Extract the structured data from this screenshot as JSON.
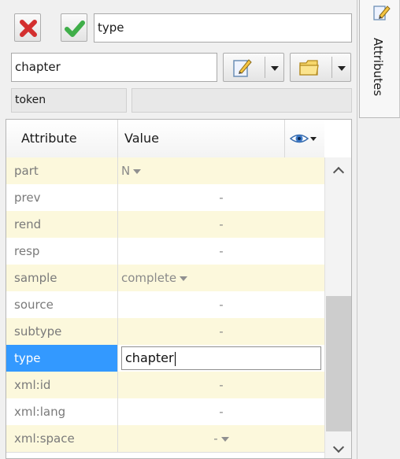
{
  "toolbar": {
    "name_value": "type",
    "element_value": "chapter",
    "token_label": "token"
  },
  "sidebar": {
    "tab_label": "Attributes"
  },
  "table": {
    "headers": {
      "attribute": "Attribute",
      "value": "Value"
    },
    "rows": [
      {
        "name": "part",
        "value": "N",
        "dropdown": true,
        "align": "left"
      },
      {
        "name": "prev",
        "value": "-",
        "dropdown": false,
        "align": "center"
      },
      {
        "name": "rend",
        "value": "-",
        "dropdown": false,
        "align": "center"
      },
      {
        "name": "resp",
        "value": "-",
        "dropdown": false,
        "align": "center"
      },
      {
        "name": "sample",
        "value": "complete",
        "dropdown": true,
        "align": "left"
      },
      {
        "name": "source",
        "value": "-",
        "dropdown": false,
        "align": "center"
      },
      {
        "name": "subtype",
        "value": "-",
        "dropdown": false,
        "align": "center"
      },
      {
        "name": "type",
        "value": "chapter",
        "dropdown": false,
        "align": "edit",
        "selected": true
      },
      {
        "name": "xml:id",
        "value": "-",
        "dropdown": false,
        "align": "center"
      },
      {
        "name": "xml:lang",
        "value": "-",
        "dropdown": false,
        "align": "center"
      },
      {
        "name": "xml:space",
        "value": "-",
        "dropdown": true,
        "align": "center"
      }
    ]
  },
  "colors": {
    "row_alt": "#fcf8dc",
    "selection": "#3399ff",
    "reject_icon": "#d32f2f",
    "accept_icon": "#3fae49"
  }
}
